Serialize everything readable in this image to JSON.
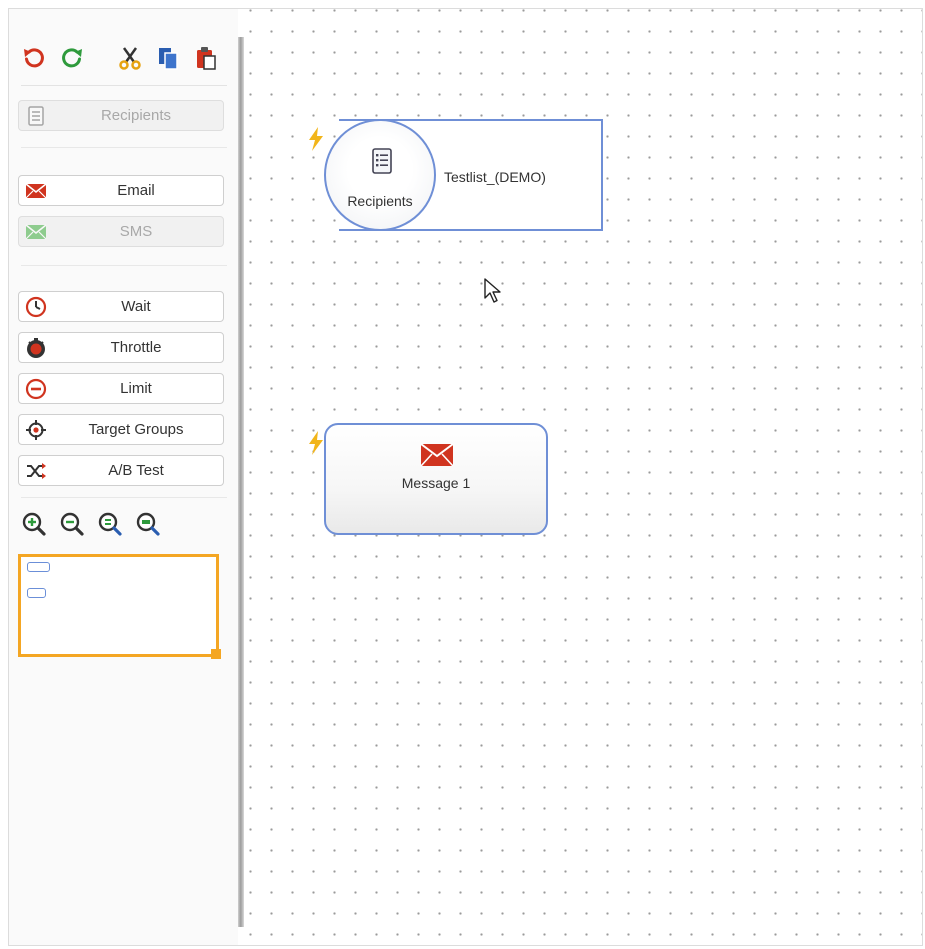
{
  "sidebar": {
    "toolbar": [
      {
        "name": "undo-icon",
        "color": "#d0341f"
      },
      {
        "name": "redo-icon",
        "color": "#2e9a3c"
      },
      {
        "name": "cut-icon",
        "color": "#333333"
      },
      {
        "name": "copy-icon",
        "color": "#2a5db0"
      },
      {
        "name": "paste-icon",
        "color": "#d0341f"
      }
    ],
    "palette": {
      "recipients_label": "Recipients",
      "email_label": "Email",
      "sms_label": "SMS",
      "wait_label": "Wait",
      "throttle_label": "Throttle",
      "limit_label": "Limit",
      "target_groups_label": "Target Groups",
      "ab_test_label": "A/B Test"
    },
    "zoom": [
      "zoom-in-icon",
      "zoom-out-icon",
      "zoom-reset-icon",
      "zoom-fit-icon"
    ]
  },
  "canvas": {
    "recipients_node": {
      "label": "Recipients",
      "list_name": "Testlist_(DEMO)"
    },
    "message_node": {
      "label": "Message 1"
    }
  },
  "colors": {
    "accent": "#6f8fd6",
    "trigger": "#f2b51a",
    "email_red": "#d0341f",
    "sms_green": "#5cb85c",
    "minimap_border": "#f4a623"
  }
}
